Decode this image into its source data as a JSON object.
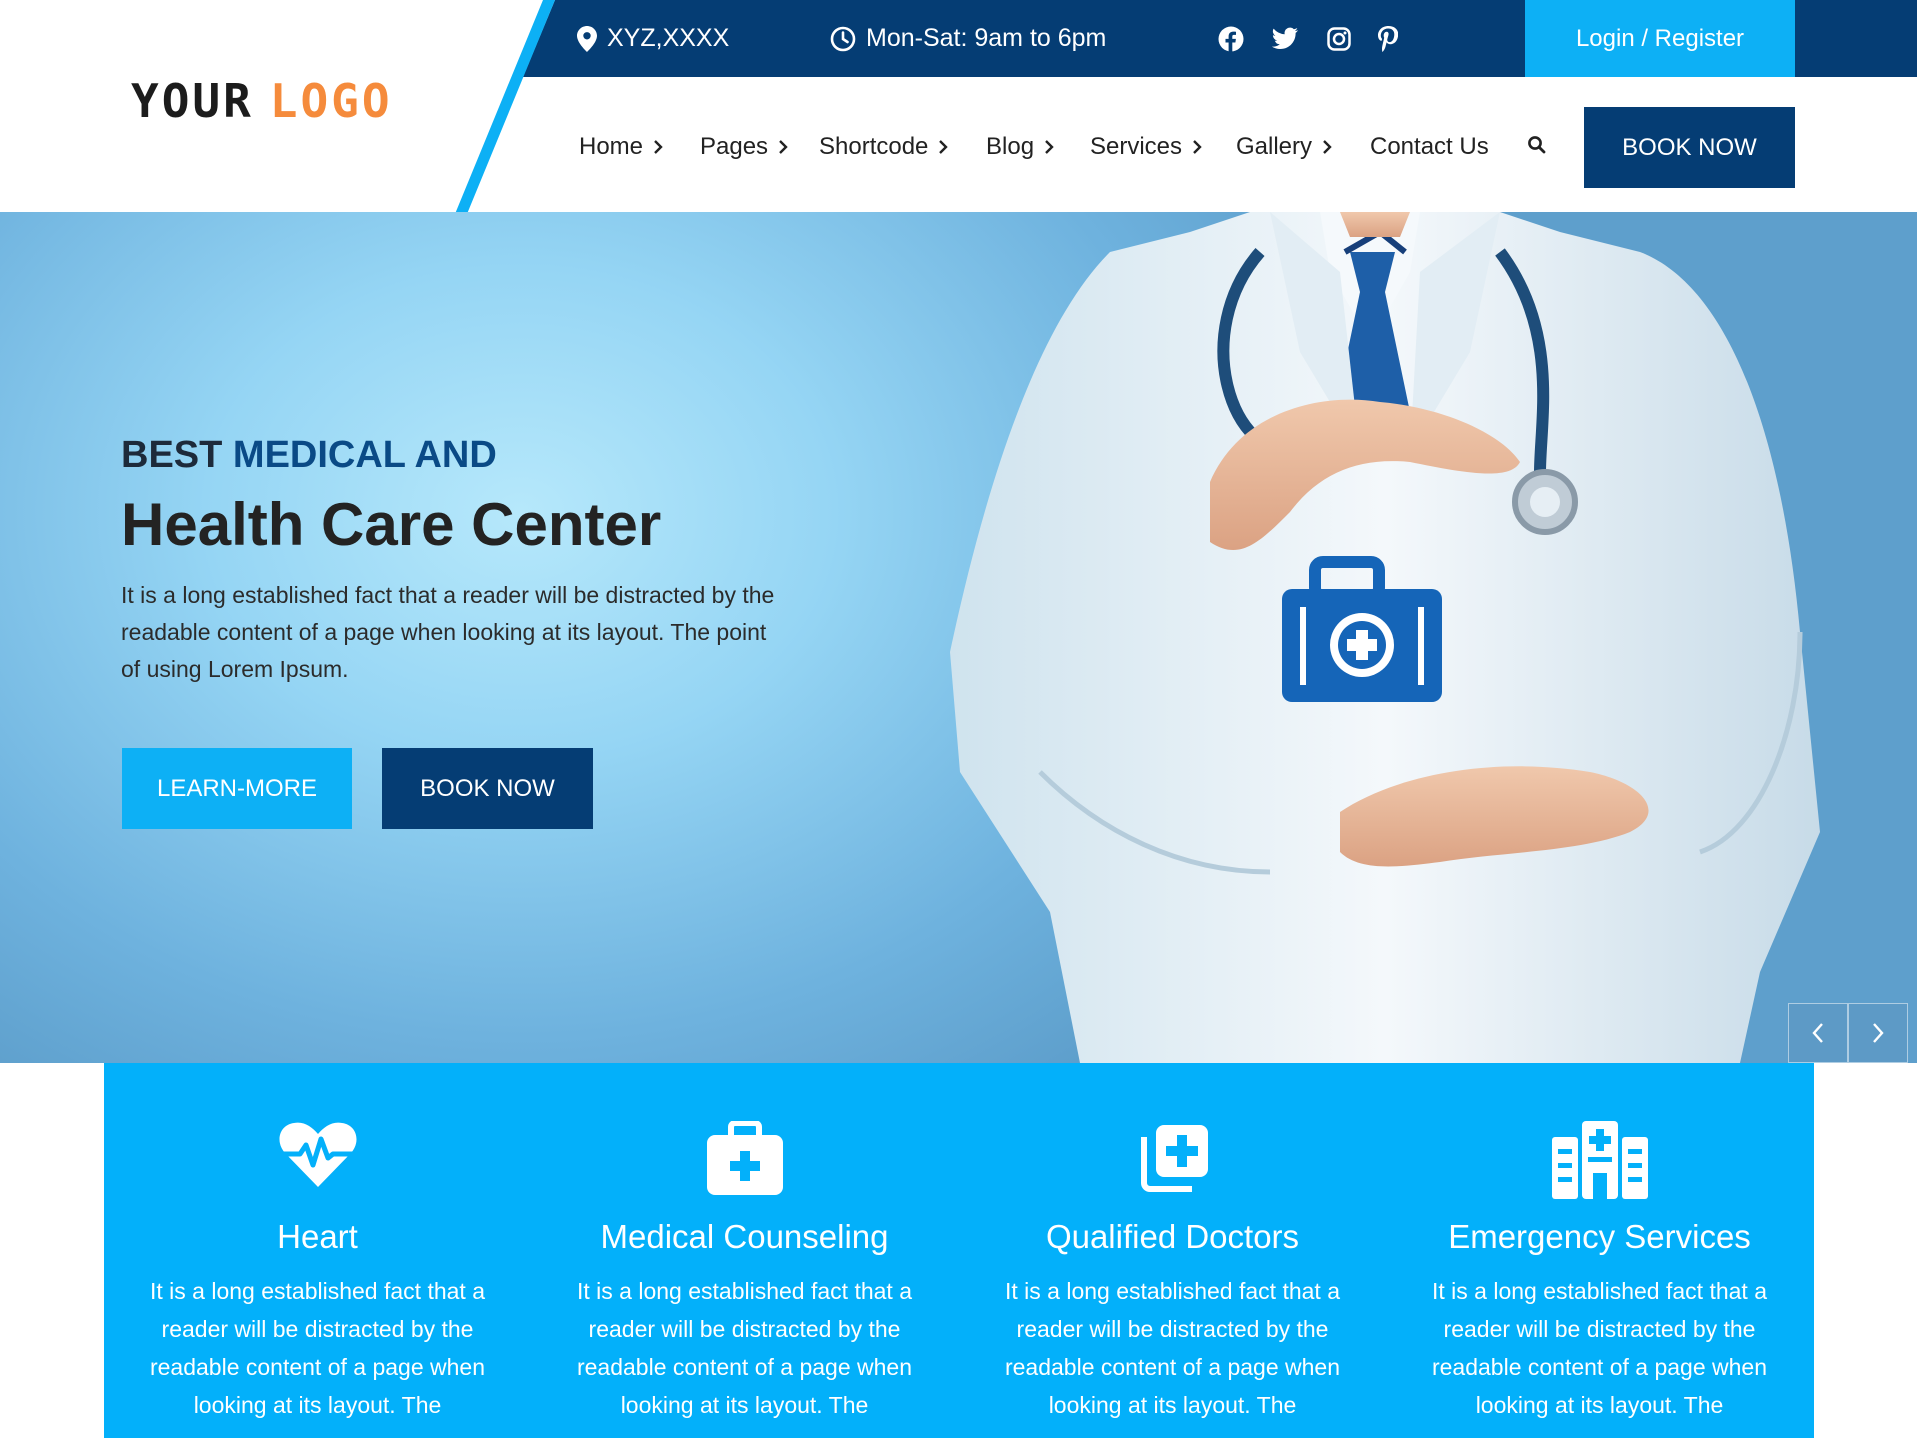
{
  "header": {
    "logo_word1": "YOUR",
    "logo_word2": "LOGO",
    "location": "XYZ,XXXX",
    "hours": "Mon-Sat: 9am to 6pm",
    "social_icons": [
      "facebook-icon",
      "twitter-icon",
      "instagram-icon",
      "pinterest-icon"
    ],
    "login_label": "Login / Register",
    "book_label": "BOOK NOW"
  },
  "nav": {
    "items": [
      {
        "label": "Home"
      },
      {
        "label": "Pages"
      },
      {
        "label": "Shortcode"
      },
      {
        "label": "Blog"
      },
      {
        "label": "Services"
      },
      {
        "label": "Gallery"
      },
      {
        "label": "Contact Us"
      }
    ]
  },
  "hero": {
    "kicker_plain": "BEST",
    "kicker_accent": "MEDICAL AND",
    "title": "Health Care Center",
    "text": "It is a long established fact that a reader will be distracted by the readable content of a page when looking at its layout. The point of using Lorem Ipsum.",
    "learn_label": "LEARN-MORE",
    "book_label": "BOOK NOW"
  },
  "features": [
    {
      "icon": "heart-pulse-icon",
      "title": "Heart",
      "text": "It is a long established fact that a reader will be distracted by the readable content of a page when looking at its layout. The"
    },
    {
      "icon": "medical-kit-icon",
      "title": "Medical Counseling",
      "text": "It is a long established fact that a reader will be distracted by the readable content of a page when looking at its layout. The"
    },
    {
      "icon": "clinic-files-icon",
      "title": "Qualified Doctors",
      "text": "It is a long established fact that a reader will be distracted by the readable content of a page when looking at its layout. The"
    },
    {
      "icon": "hospital-icon",
      "title": "Emergency Services",
      "text": "It is a long established fact that a reader will be distracted by the readable content of a page when looking at its layout. The"
    }
  ],
  "colors": {
    "navy": "#053d74",
    "sky": "#0db0f5",
    "feature_bg": "#03b0fa",
    "logo_accent": "#f58b3c"
  }
}
